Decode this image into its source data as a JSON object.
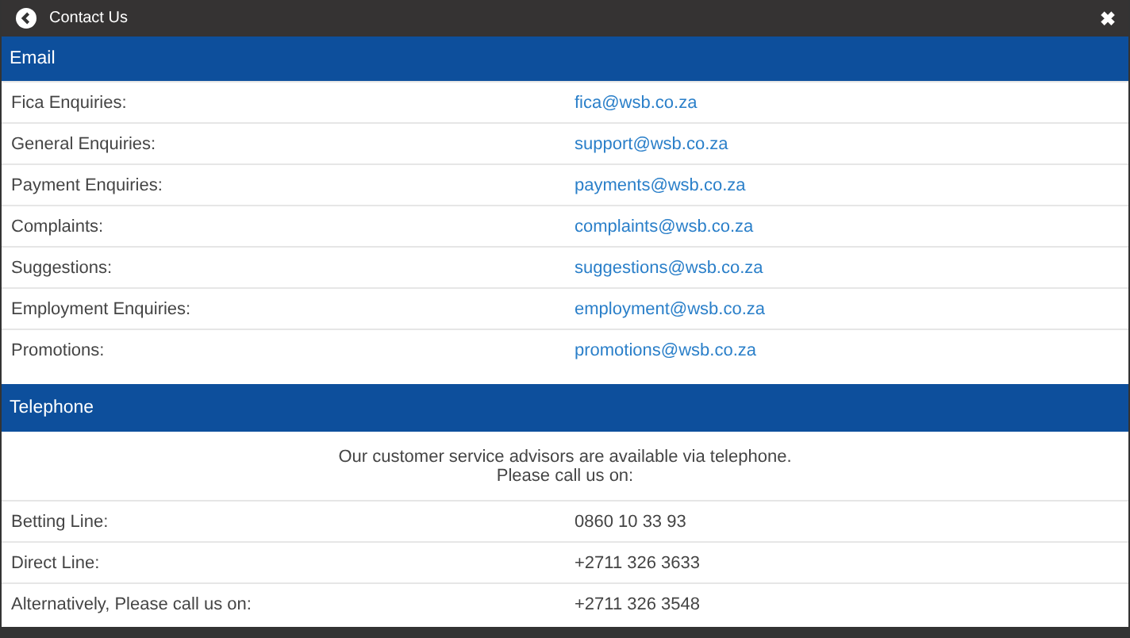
{
  "header": {
    "title": "Contact Us",
    "close_icon": "✖"
  },
  "email": {
    "heading": "Email",
    "rows": [
      {
        "label": "Fica Enquiries:",
        "value": "fica@wsb.co.za"
      },
      {
        "label": "General Enquiries:",
        "value": "support@wsb.co.za"
      },
      {
        "label": "Payment Enquiries:",
        "value": "payments@wsb.co.za"
      },
      {
        "label": "Complaints:",
        "value": "complaints@wsb.co.za"
      },
      {
        "label": "Suggestions:",
        "value": "suggestions@wsb.co.za"
      },
      {
        "label": "Employment Enquiries:",
        "value": "employment@wsb.co.za"
      },
      {
        "label": "Promotions:",
        "value": "promotions@wsb.co.za"
      }
    ]
  },
  "telephone": {
    "heading": "Telephone",
    "intro": [
      "Our customer service advisors are available via telephone.",
      "Please call us on:"
    ],
    "rows": [
      {
        "label": "Betting Line:",
        "value": "0860 10 33 93"
      },
      {
        "label": "Direct Line:",
        "value": "+2711 326 3633"
      },
      {
        "label": "Alternatively, Please call us on:",
        "value": "+2711 326 3548"
      }
    ]
  }
}
